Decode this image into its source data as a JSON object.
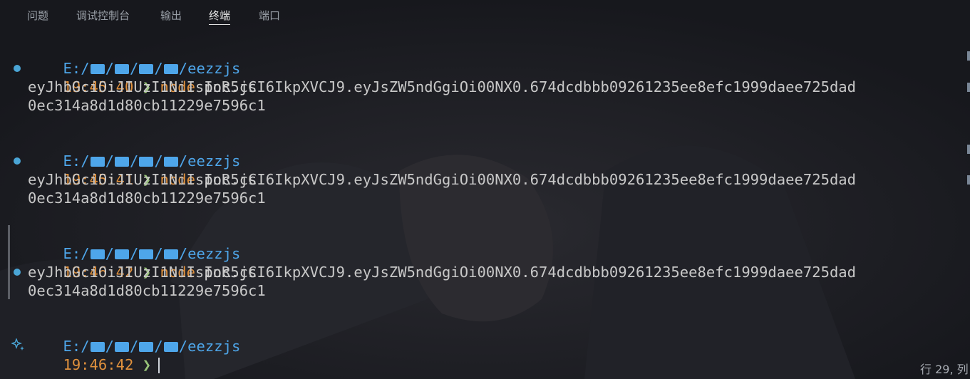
{
  "tabs": [
    {
      "label": "问题"
    },
    {
      "label": "调试控制台"
    },
    {
      "label": "输出"
    },
    {
      "label": "终端"
    },
    {
      "label": "端口"
    }
  ],
  "active_tab": "终端",
  "terminal": {
    "blocks": [
      {
        "path": "E:/■/■/■/■/eezzjs",
        "time": "19:45:40",
        "arrow": "❯",
        "command": "node",
        "argument": "poc.js",
        "output_line1": "eyJhbGciOiJIUzI1NiIsInR5cCI6IkpXVCJ9.eyJsZW5ndGgiOi00NX0.674dcdbbb09261235ee8efc1999daee725dad",
        "output_line2": "0ec314a8d1d80cb11229e7596c1"
      },
      {
        "path": "E:/■/■/■/■/eezzjs",
        "time": "19:45:41",
        "arrow": "❯",
        "command": "node",
        "argument": "poc.js",
        "output_line1": "eyJhbGciOiJIUzI1NiIsInR5cCI6IkpXVCJ9.eyJsZW5ndGgiOi00NX0.674dcdbbb09261235ee8efc1999daee725dad",
        "output_line2": "0ec314a8d1d80cb11229e7596c1"
      },
      {
        "path": "E:/■/■/■/■/eezzjs",
        "time": "19:46:42",
        "arrow": "❯",
        "command": "node",
        "argument": "poc.js",
        "output_line1": "eyJhbGciOiJIUzI1NiIsInR5cCI6IkpXVCJ9.eyJsZW5ndGgiOi00NX0.674dcdbbb09261235ee8efc1999daee725dad",
        "output_line2": "0ec314a8d1d80cb11229e7596c1"
      }
    ],
    "current_prompt": {
      "path": "E:/■/■/■/■/eezzjs",
      "time": "19:46:42",
      "arrow": "❯"
    }
  },
  "status_bar": {
    "cursor_position": "行 29, 列"
  },
  "colors": {
    "background": "#1b1c22",
    "path": "#4ea6ea",
    "time": "#e0913d",
    "arrow": "#98c379",
    "decoration_dot": "#4aa5d6"
  },
  "icons": [
    "folder-icon",
    "sparkle-icon",
    "command-decoration-icon"
  ]
}
